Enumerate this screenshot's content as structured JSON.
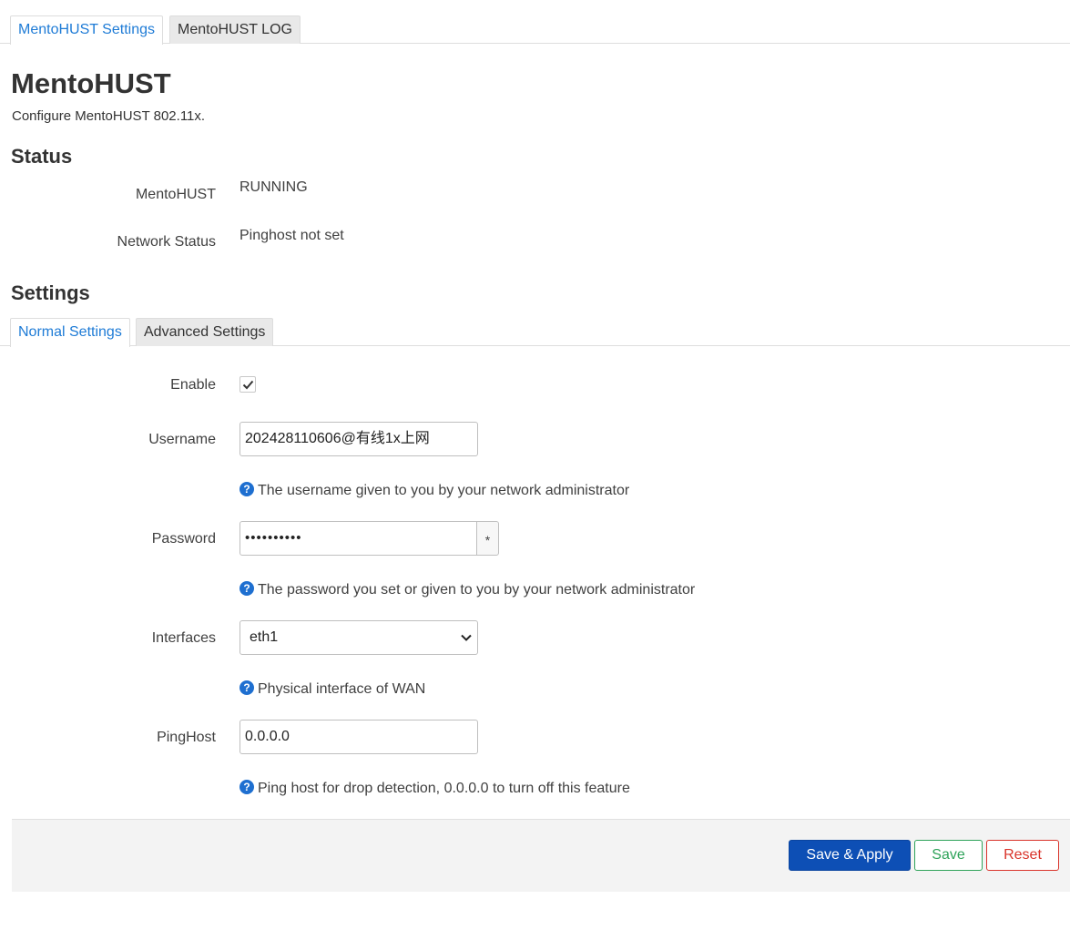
{
  "tabs_top": [
    {
      "label": "MentoHUST Settings",
      "active": true
    },
    {
      "label": "MentoHUST LOG",
      "active": false
    }
  ],
  "title": "MentoHUST",
  "subtitle": "Configure MentoHUST 802.11x.",
  "status": {
    "heading": "Status",
    "rows": [
      {
        "label": "MentoHUST",
        "value": "RUNNING"
      },
      {
        "label": "Network Status",
        "value": "Pinghost not set"
      }
    ]
  },
  "settings": {
    "heading": "Settings",
    "tabs": [
      {
        "label": "Normal Settings",
        "active": true
      },
      {
        "label": "Advanced Settings",
        "active": false
      }
    ],
    "enable": {
      "label": "Enable",
      "checked": true
    },
    "username": {
      "label": "Username",
      "value": "202428110606@有线1x上网",
      "help": "The username given to you by your network administrator"
    },
    "password": {
      "label": "Password",
      "value": "••••••••••",
      "reveal": "*",
      "help": "The password you set or given to you by your network administrator"
    },
    "interfaces": {
      "label": "Interfaces",
      "value": "eth1",
      "help": "Physical interface of WAN"
    },
    "pinghost": {
      "label": "PingHost",
      "value": "0.0.0.0",
      "help": "Ping host for drop detection, 0.0.0.0 to turn off this feature"
    }
  },
  "help_glyph": "?",
  "buttons": {
    "save_apply": "Save & Apply",
    "save": "Save",
    "reset": "Reset"
  },
  "colors": {
    "accent": "#1e7bd6",
    "apply": "#0d4fb5",
    "save": "#2fa35a",
    "reset": "#d9342b"
  }
}
